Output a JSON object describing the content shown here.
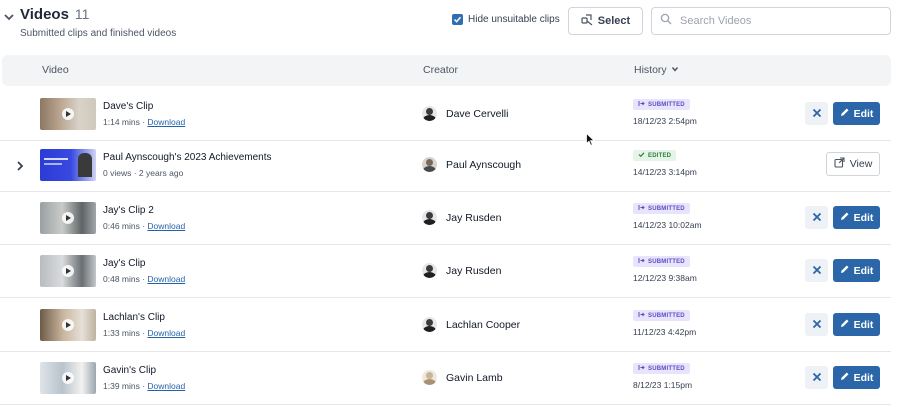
{
  "header": {
    "title": "Videos",
    "count": "11",
    "subtitle": "Submitted clips and finished videos",
    "hide_label": "Hide unsuitable clips",
    "hide_checked": true,
    "select_label": "Select",
    "search_placeholder": "Search Videos"
  },
  "table": {
    "columns": {
      "video": "Video",
      "creator": "Creator",
      "history": "History"
    }
  },
  "rows": [
    {
      "name": "Dave's Clip",
      "duration": "1:14 mins",
      "sep": " · ",
      "download": "Download",
      "creator": "Dave Cervelli",
      "status": "SUBMITTED",
      "status_type": "submitted",
      "date": "18/12/23 2:54pm",
      "action": "edit",
      "edit_label": "Edit"
    },
    {
      "name": "Paul Aynscough's 2023 Achievements",
      "duration": "0 views · 2 years ago",
      "sep": "",
      "download": "",
      "creator": "Paul Aynscough",
      "status": "EDITED",
      "status_type": "edited",
      "date": "14/12/23 3:14pm",
      "action": "view",
      "view_label": "View"
    },
    {
      "name": "Jay's Clip 2",
      "duration": "0:46 mins",
      "sep": " · ",
      "download": "Download",
      "creator": "Jay Rusden",
      "status": "SUBMITTED",
      "status_type": "submitted",
      "date": "14/12/23 10:02am",
      "action": "edit",
      "edit_label": "Edit"
    },
    {
      "name": "Jay's Clip",
      "duration": "0:48 mins",
      "sep": " · ",
      "download": "Download",
      "creator": "Jay Rusden",
      "status": "SUBMITTED",
      "status_type": "submitted",
      "date": "12/12/23 9:38am",
      "action": "edit",
      "edit_label": "Edit"
    },
    {
      "name": "Lachlan's Clip",
      "duration": "1:33 mins",
      "sep": " · ",
      "download": "Download",
      "creator": "Lachlan Cooper",
      "status": "SUBMITTED",
      "status_type": "submitted",
      "date": "11/12/23 4:42pm",
      "action": "edit",
      "edit_label": "Edit"
    },
    {
      "name": "Gavin's Clip",
      "duration": "1:39 mins",
      "sep": " · ",
      "download": "Download",
      "creator": "Gavin Lamb",
      "status": "SUBMITTED",
      "status_type": "submitted",
      "date": "8/12/23 1:15pm",
      "action": "edit",
      "edit_label": "Edit"
    }
  ],
  "colors": {
    "accent": "#2a66a8",
    "submitted_bg": "#e7e4fb",
    "submitted_text": "#5b4ec4",
    "edited_bg": "#e4f5e7",
    "edited_text": "#2e7d3e"
  },
  "icons": {
    "collapse": "chevron-down-icon",
    "expand": "chevron-right-icon",
    "select": "select-icon",
    "search": "search-icon",
    "history_sort": "chevron-down-icon",
    "submitted": "submit-arrow-icon",
    "edited": "check-icon",
    "dismiss": "close-icon",
    "edit": "pencil-icon",
    "view": "external-link-icon"
  }
}
